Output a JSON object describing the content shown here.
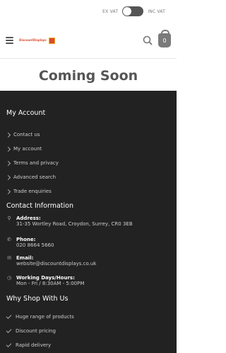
{
  "vat_toggle": {
    "ex_label": "EX VAT",
    "inc_label": "INC VAT"
  },
  "header": {
    "logo_text": "DiscountDisplays",
    "cart_count": "0"
  },
  "page_title": "Coming Soon",
  "footer": {
    "my_account": {
      "heading": "My Account",
      "links": [
        "Contact us",
        "My account",
        "Terms and privacy",
        "Advanced search",
        "Trade enquiries"
      ]
    },
    "contact": {
      "heading": "Contact Information",
      "address_label": "Address:",
      "address": "31-35 Wortley Road, Croydon, Surrey, CR0 3EB",
      "phone_label": "Phone:",
      "phone": "020 8664 5660",
      "email_label": "Email:",
      "email": "website@discountdisplays.co.uk",
      "hours_label": "Working Days/Hours:",
      "hours": "Mon - Fri / 8:30AM - 5:00PM"
    },
    "why_shop": {
      "heading": "Why Shop With Us",
      "items": [
        "Huge range of products",
        "Discount pricing",
        "Rapid delivery"
      ]
    }
  }
}
